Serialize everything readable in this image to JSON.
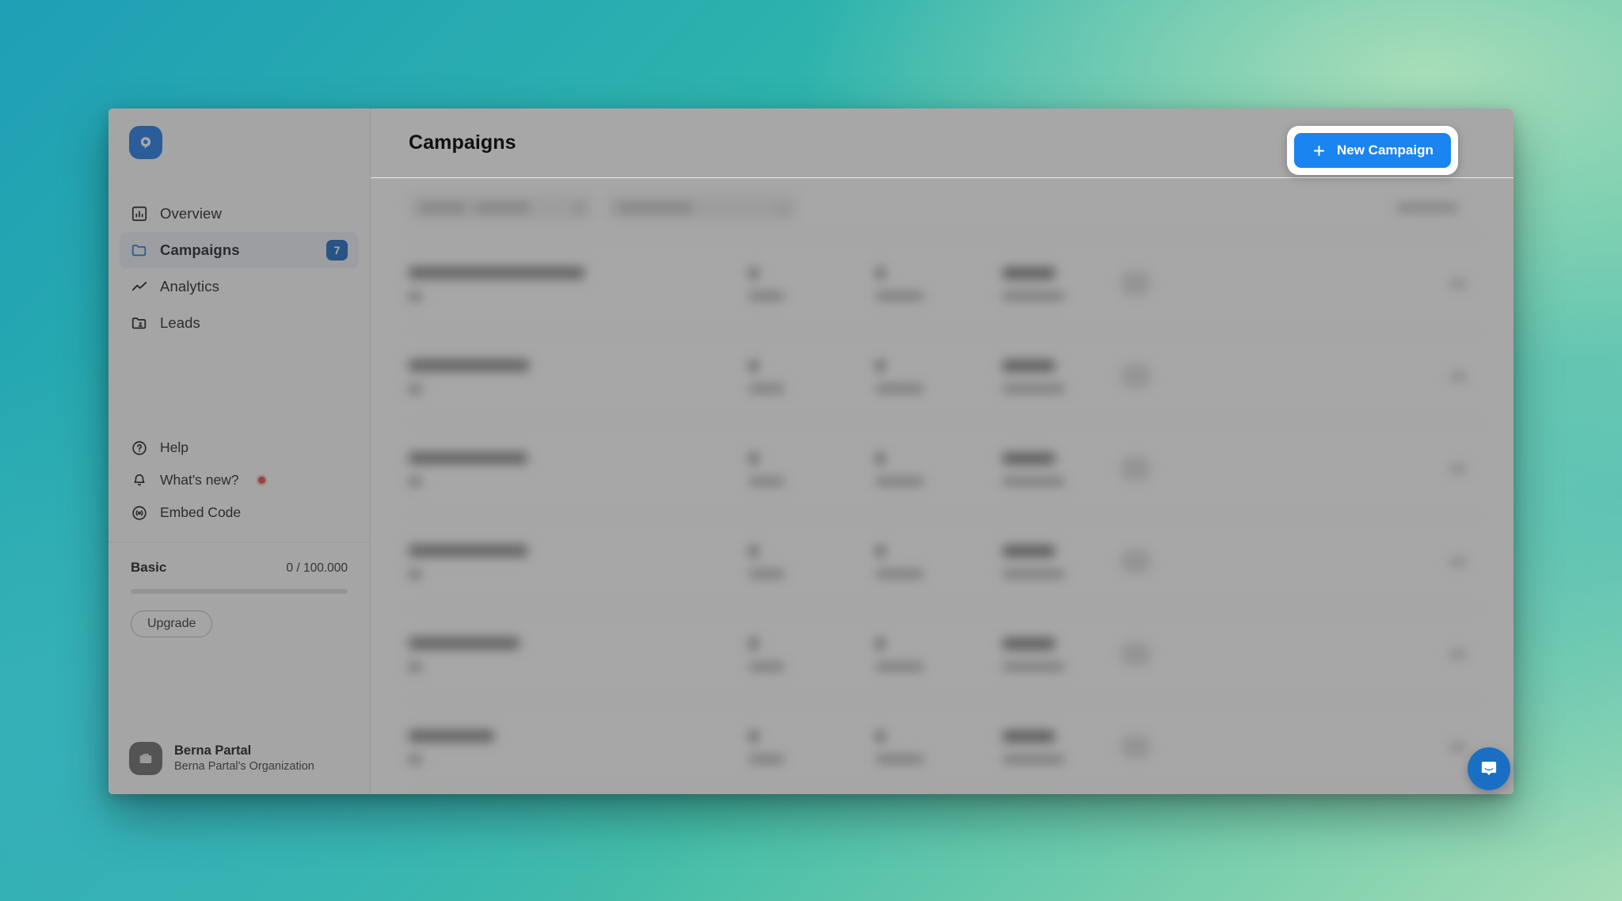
{
  "window": {
    "logo_icon": "app-logo-p-mark"
  },
  "sidebar": {
    "nav_items": [
      {
        "label": "Overview",
        "icon": "chart-bar-icon",
        "badge": "",
        "active": false
      },
      {
        "label": "Campaigns",
        "icon": "folder-icon",
        "badge": "7",
        "active": true
      },
      {
        "label": "Analytics",
        "icon": "trending-up-icon",
        "badge": "",
        "active": false
      },
      {
        "label": "Leads",
        "icon": "folder-user-icon",
        "badge": "",
        "active": false
      }
    ],
    "secondary_items": [
      {
        "label": "Help",
        "icon": "question-circle-icon",
        "dot": false
      },
      {
        "label": "What's new?",
        "icon": "bell-icon",
        "dot": true
      },
      {
        "label": "Embed Code",
        "icon": "broadcast-icon",
        "dot": false
      }
    ],
    "plan": {
      "name": "Basic",
      "usage": "0 / 100.000",
      "progress_percent": 0,
      "upgrade_label": "Upgrade"
    },
    "user": {
      "name": "Berna Partal",
      "organization": "Berna Partal's Organization",
      "avatar_icon": "briefcase-icon"
    }
  },
  "header": {
    "title": "Campaigns"
  },
  "primary_action": {
    "label": "New Campaign",
    "icon": "plus-icon",
    "color": "#1a84f0",
    "highlighted": true
  },
  "content": {
    "blurred": true,
    "toolbar": {
      "search_placeholder": "",
      "filter_label": "",
      "sort_label": ""
    },
    "table_rows": [
      {
        "name": "",
        "stat_a": "",
        "stat_b": "",
        "date": "",
        "badge": ""
      },
      {
        "name": "",
        "stat_a": "",
        "stat_b": "",
        "date": "",
        "badge": ""
      },
      {
        "name": "",
        "stat_a": "",
        "stat_b": "",
        "date": "",
        "badge": ""
      },
      {
        "name": "",
        "stat_a": "",
        "stat_b": "",
        "date": "",
        "badge": ""
      },
      {
        "name": "",
        "stat_a": "",
        "stat_b": "",
        "date": "",
        "badge": ""
      },
      {
        "name": "",
        "stat_a": "",
        "stat_b": "",
        "date": "",
        "badge": ""
      }
    ]
  },
  "chat_widget": {
    "icon": "intercom-message-icon",
    "color": "#1a6fc4"
  }
}
